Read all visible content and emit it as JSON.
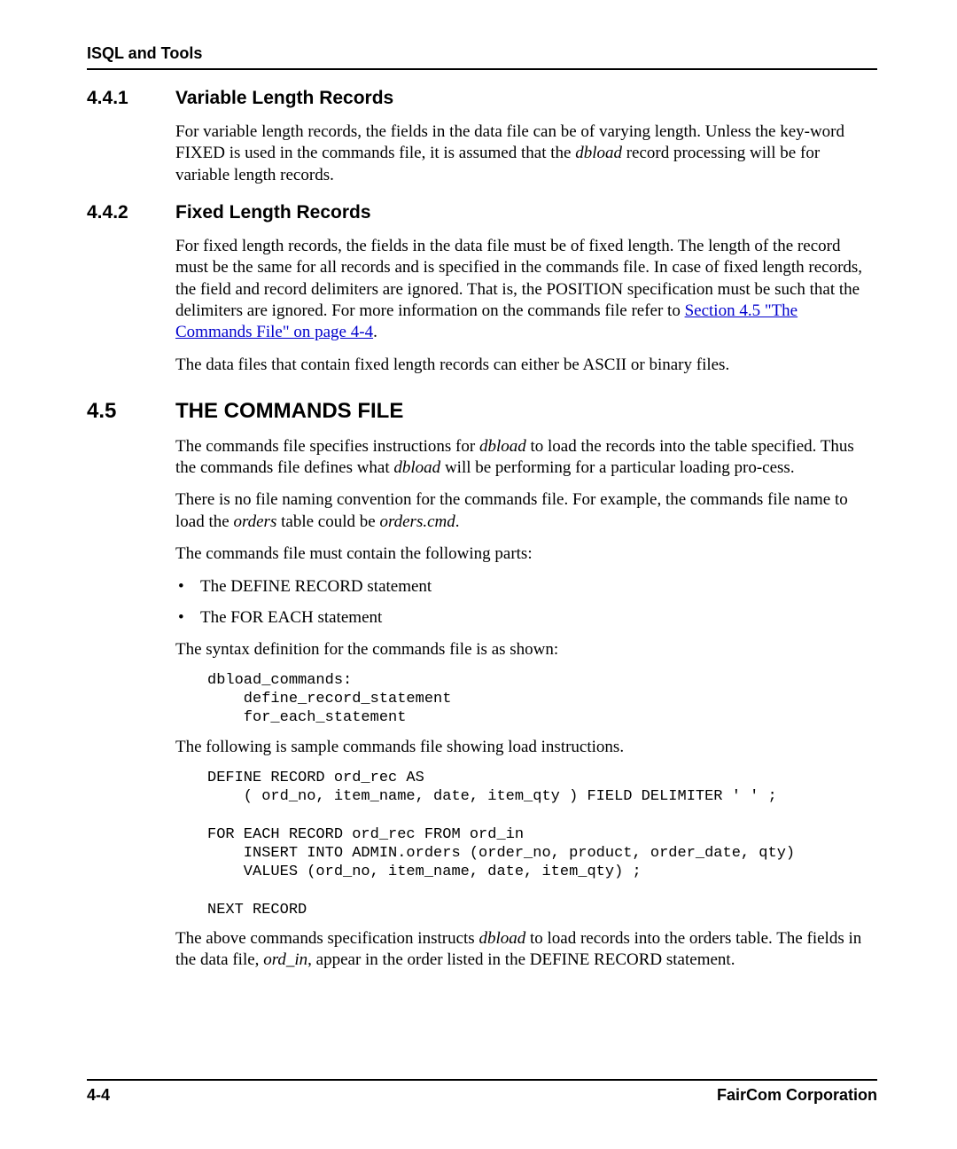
{
  "header": {
    "title": "ISQL and Tools"
  },
  "sections": {
    "s441": {
      "num": "4.4.1",
      "title": "Variable Length Records",
      "p1a": "For variable length records, the fields in the data file can be of varying length. Unless the key-word FIXED is used in the commands file, it is assumed that the ",
      "p1em": "dbload",
      "p1b": " record processing will be for variable length records."
    },
    "s442": {
      "num": "4.4.2",
      "title": "Fixed Length Records",
      "p1a": "For fixed length records, the fields in the data file must be of fixed length. The length of the record must be the same for all records and is specified in the commands file. In case of fixed length records, the field and record delimiters are ignored. That is, the POSITION specification must be such that the delimiters are ignored. For more information on the commands file refer to ",
      "p1link": "Section 4.5 \"The Commands File\" on page 4-4",
      "p1b": ".",
      "p2": "The data files that contain fixed length records can either be ASCII or binary files."
    },
    "s45": {
      "num": "4.5",
      "title": "THE COMMANDS FILE",
      "p1a": "The commands file specifies instructions for ",
      "p1em1": "dbload",
      "p1b": " to load the records into the table specified. Thus the commands file defines what ",
      "p1em2": "dbload",
      "p1c": " will be performing for a particular loading pro-cess.",
      "p2a": "There is no file naming convention for the commands file. For example, the commands file name to load the ",
      "p2em1": "orders",
      "p2b": " table could be ",
      "p2em2": "orders.cmd",
      "p2c": ".",
      "p3": "The commands file must contain the following parts:",
      "bullets": {
        "b1": "The DEFINE RECORD statement",
        "b2": "The FOR EACH statement"
      },
      "p4": "The syntax definition for the commands file is as shown:",
      "code1": "dbload_commands:\n    define_record_statement\n    for_each_statement",
      "p5": "The following is sample commands file showing load instructions.",
      "code2": "DEFINE RECORD ord_rec AS\n    ( ord_no, item_name, date, item_qty ) FIELD DELIMITER ' ' ;\n\nFOR EACH RECORD ord_rec FROM ord_in\n    INSERT INTO ADMIN.orders (order_no, product, order_date, qty)\n    VALUES (ord_no, item_name, date, item_qty) ;\n\nNEXT RECORD",
      "p6a": "The above commands specification instructs ",
      "p6em1": "dbload",
      "p6b": " to load records into the orders table. The fields in the data file, ",
      "p6em2": "ord_in",
      "p6c": ", appear in the order listed in the DEFINE RECORD statement."
    }
  },
  "footer": {
    "page": "4-4",
    "org": "FairCom Corporation"
  }
}
